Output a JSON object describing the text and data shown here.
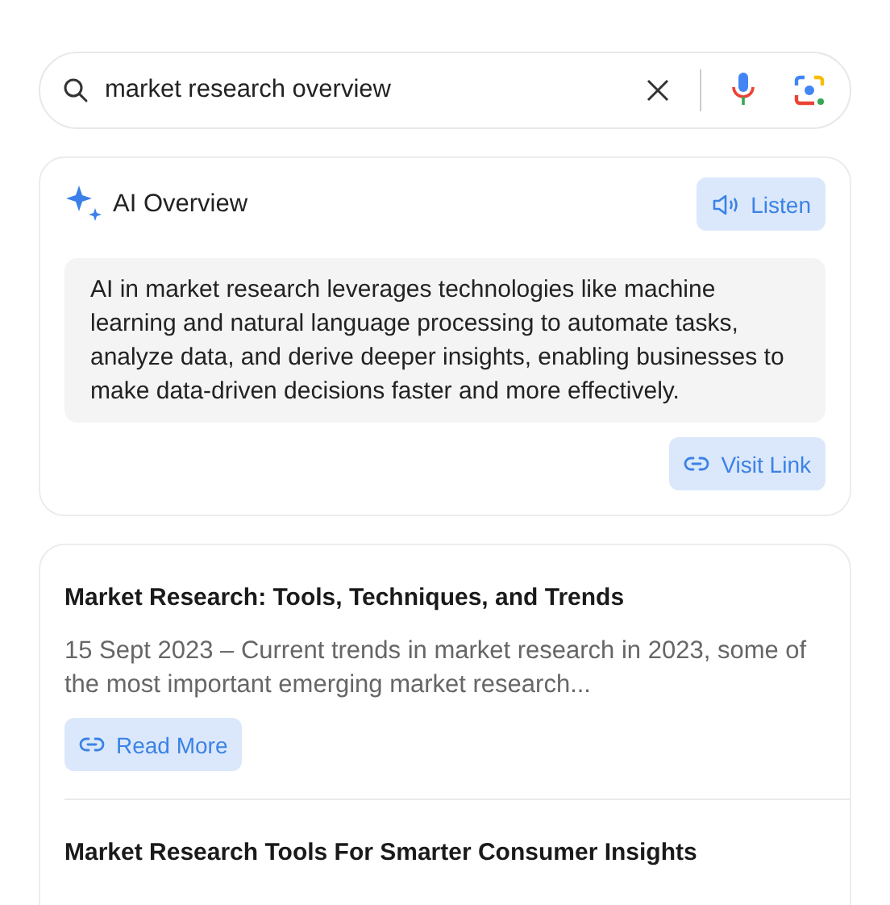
{
  "search": {
    "value": "market research overview"
  },
  "ai_overview": {
    "title": "AI Overview",
    "listen_button": "Listen",
    "summary": "AI in market research leverages technologies like machine learning and natural language processing to automate tasks, analyze data, and derive deeper insights, enabling businesses to make data-driven decisions faster and more effectively.",
    "link_button": "Visit Link"
  },
  "results": [
    {
      "title": "Market Research: Tools, Techniques, and Trends",
      "snippet": "15 Sept 2023 – Current trends in market research in 2023, some of the most important emerging market research...",
      "button": "Read More"
    },
    {
      "title": "Market Research Tools For Smarter Consumer Insights"
    }
  ]
}
